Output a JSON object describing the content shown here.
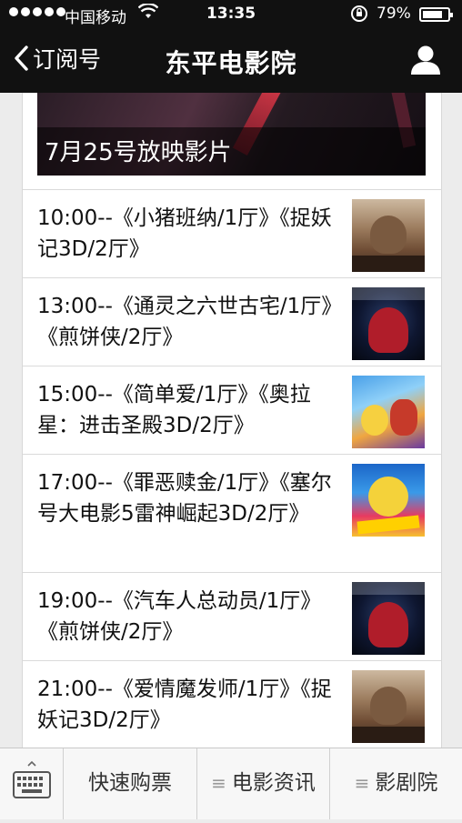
{
  "status_bar": {
    "carrier": "中国移动",
    "time": "13:35",
    "battery": "79%",
    "battery_level": 0.79
  },
  "nav": {
    "back_label": "订阅号",
    "title": "东平电影院"
  },
  "banner": {
    "caption": "7月25号放映影片"
  },
  "showtimes": [
    {
      "text": "10:00--《小猪班纳/1厅》《捉妖记3D/2厅》",
      "thumb": "monkey"
    },
    {
      "text": "13:00--《通灵之六世古宅/1厅》《煎饼侠/2厅》",
      "thumb": "spider"
    },
    {
      "text": "15:00--《简单爱/1厅》《奥拉星：进击圣殿3D/2厅》",
      "thumb": "toon"
    },
    {
      "text": "17:00--《罪恶赎金/1厅》《塞尔号大电影5雷神崛起3D/2厅》",
      "thumb": "seer"
    },
    {
      "text": "19:00--《汽车人总动员/1厅》《煎饼侠/2厅》",
      "thumb": "spider"
    },
    {
      "text": "21:00--《爱情魔发师/1厅》《捉妖记3D/2厅》",
      "thumb": "monkey"
    }
  ],
  "bottom_menu": {
    "items": [
      {
        "label": "快速购票"
      },
      {
        "label": "电影资讯"
      },
      {
        "label": "影剧院"
      }
    ]
  },
  "icons": {
    "signal": "signal-dots-icon",
    "wifi": "wifi-icon",
    "lock": "rotation-lock-icon",
    "back": "chevron-left-icon",
    "profile": "person-icon",
    "keyboard": "keyboard-icon",
    "submenu": "menu-lines-icon"
  }
}
